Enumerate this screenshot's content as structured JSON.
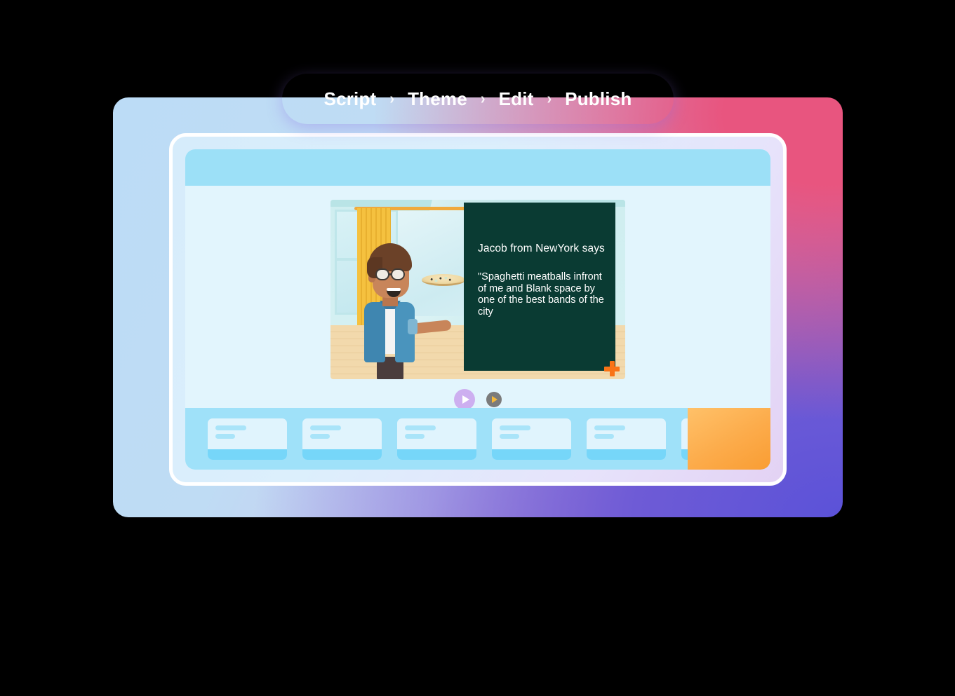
{
  "breadcrumb": {
    "name": "workflow-steps",
    "separator": "›",
    "steps": [
      {
        "label": "Script",
        "active": false
      },
      {
        "label": "Theme",
        "active": false
      },
      {
        "label": "Edit",
        "active": true
      },
      {
        "label": "Publish",
        "active": false
      }
    ]
  },
  "app": {
    "header_title": "",
    "canvas": {
      "scene_description": "character-holding-pizza-in-room",
      "text_overlay": {
        "title": "Jacob from NewYork says",
        "quote": "\"Spaghetti meatballs infront of me and Blank space by one of the best bands of the city",
        "background_color": "#0a3b33",
        "text_color": "#ffffff"
      },
      "add_icon": "plus-icon",
      "add_icon_color": "#f97316"
    },
    "controls": {
      "play_main": {
        "icon": "play-icon",
        "color": "#cdaff0",
        "glyph_color": "#ffffff"
      },
      "play_secondary": {
        "icon": "play-icon",
        "color": "#7b7b7b",
        "glyph_color": "#f5b93a"
      }
    },
    "timeline": {
      "background_color": "#9fe1f9",
      "scenes": [
        {
          "id": "scene-1"
        },
        {
          "id": "scene-2"
        },
        {
          "id": "scene-3"
        },
        {
          "id": "scene-4"
        },
        {
          "id": "scene-5"
        },
        {
          "id": "scene-6"
        }
      ],
      "panel": {
        "name": "add-scene-panel",
        "color": "#fcab4a"
      }
    }
  },
  "colors": {
    "breadcrumb_gradient_start": "#f07ff2",
    "breadcrumb_gradient_end": "#5f9bf7",
    "card_blue": "#bcdcf6",
    "card_pink": "#e8557f",
    "card_purple": "#5b52d8",
    "app_header": "#9ce0f7",
    "app_body": "#e2f5fd"
  }
}
